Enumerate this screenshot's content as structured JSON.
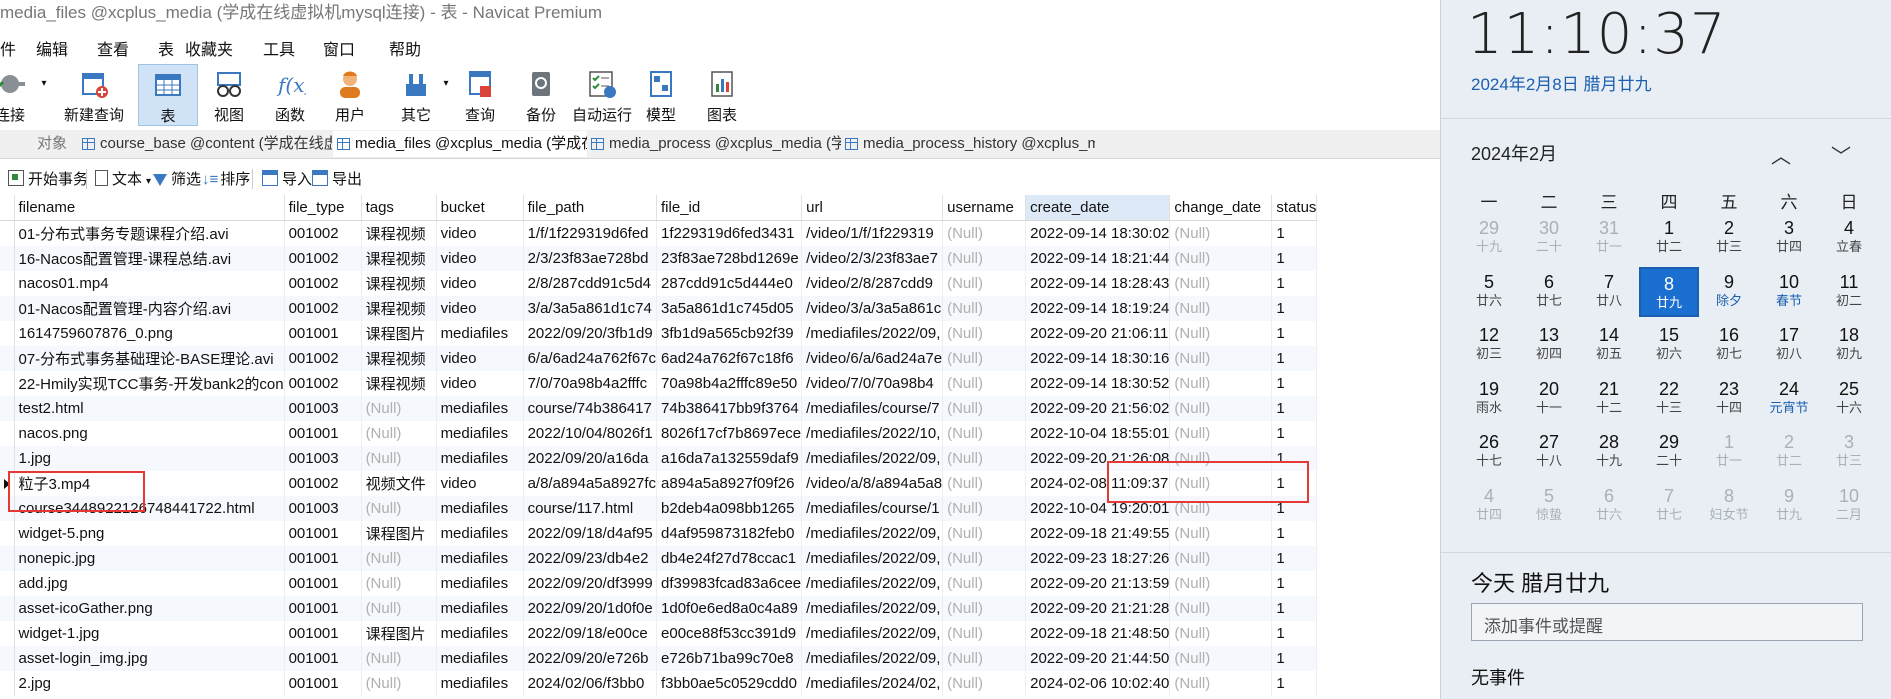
{
  "window": {
    "title": "media_files @xcplus_media (学成在线虚拟机mysql连接) - 表 - Navicat Premium"
  },
  "menu": [
    "件",
    "编辑",
    "查看",
    "表",
    "收藏夹",
    "工具",
    "窗口",
    "帮助"
  ],
  "toolbar": [
    {
      "label": "连接",
      "icon": "plug-icon"
    },
    {
      "label": "新建查询",
      "icon": "new-query-icon"
    },
    {
      "label": "表",
      "icon": "table-icon"
    },
    {
      "label": "视图",
      "icon": "view-icon"
    },
    {
      "label": "函数",
      "icon": "function-icon"
    },
    {
      "label": "用户",
      "icon": "user-icon"
    },
    {
      "label": "其它",
      "icon": "tools-icon"
    },
    {
      "label": "查询",
      "icon": "query-icon"
    },
    {
      "label": "备份",
      "icon": "backup-icon"
    },
    {
      "label": "自动运行",
      "icon": "schedule-icon"
    },
    {
      "label": "模型",
      "icon": "model-icon"
    },
    {
      "label": "图表",
      "icon": "chart-icon"
    }
  ],
  "tabs": [
    {
      "label": "对象"
    },
    {
      "label": "course_base @content (学成在线虚拟..."
    },
    {
      "label": "media_files @xcplus_media (学成在..."
    },
    {
      "label": "media_process @xcplus_media (学成..."
    },
    {
      "label": "media_process_history @xcplus_me..."
    }
  ],
  "actions": {
    "begin": "开始事务",
    "text": "文本",
    "filter": "筛选",
    "sort": "排序",
    "import": "导入",
    "export": "导出"
  },
  "grid": {
    "columns": [
      "filename",
      "file_type",
      "tags",
      "bucket",
      "file_path",
      "file_id",
      "url",
      "username",
      "create_date",
      "change_date",
      "status"
    ],
    "rows": [
      [
        "01-分布式事务专题课程介绍.avi",
        "001002",
        "课程视频",
        "video",
        "1/f/1f229319d6fed",
        "1f229319d6fed3431",
        "/video/1/f/1f229319",
        "(Null)",
        "2022-09-14 18:30:02",
        "(Null)",
        "1"
      ],
      [
        "16-Nacos配置管理-课程总结.avi",
        "001002",
        "课程视频",
        "video",
        "2/3/23f83ae728bd",
        "23f83ae728bd1269e",
        "/video/2/3/23f83ae7",
        "(Null)",
        "2022-09-14 18:21:44",
        "(Null)",
        "1"
      ],
      [
        "nacos01.mp4",
        "001002",
        "课程视频",
        "video",
        "2/8/287cdd91c5d4",
        "287cdd91c5d444e0",
        "/video/2/8/287cdd9",
        "(Null)",
        "2022-09-14 18:28:43",
        "(Null)",
        "1"
      ],
      [
        "01-Nacos配置管理-内容介绍.avi",
        "001002",
        "课程视频",
        "video",
        "3/a/3a5a861d1c74",
        "3a5a861d1c745d05",
        "/video/3/a/3a5a861c",
        "(Null)",
        "2022-09-14 18:19:24",
        "(Null)",
        "1"
      ],
      [
        "1614759607876_0.png",
        "001001",
        "课程图片",
        "mediafiles",
        "2022/09/20/3fb1d9",
        "3fb1d9a565cb92f39",
        "/mediafiles/2022/09,",
        "(Null)",
        "2022-09-20 21:06:11",
        "(Null)",
        "1"
      ],
      [
        "07-分布式事务基础理论-BASE理论.avi",
        "001002",
        "课程视频",
        "video",
        "6/a/6ad24a762f67c",
        "6ad24a762f67c18f6",
        "/video/6/a/6ad24a7e",
        "(Null)",
        "2022-09-14 18:30:16",
        "(Null)",
        "1"
      ],
      [
        "22-Hmily实现TCC事务-开发bank2的con",
        "001002",
        "课程视频",
        "video",
        "7/0/70a98b4a2fffc",
        "70a98b4a2fffc89e50",
        "/video/7/0/70a98b4",
        "(Null)",
        "2022-09-14 18:30:52",
        "(Null)",
        "1"
      ],
      [
        "test2.html",
        "001003",
        "(Null)",
        "mediafiles",
        "course/74b386417",
        "74b386417bb9f3764",
        "/mediafiles/course/7",
        "(Null)",
        "2022-09-20 21:56:02",
        "(Null)",
        "1"
      ],
      [
        "nacos.png",
        "001001",
        "(Null)",
        "mediafiles",
        "2022/10/04/8026f1",
        "8026f17cf7b8697ece",
        "/mediafiles/2022/10,",
        "(Null)",
        "2022-10-04 18:55:01",
        "(Null)",
        "1"
      ],
      [
        "1.jpg",
        "001003",
        "(Null)",
        "mediafiles",
        "2022/09/20/a16da",
        "a16da7a132559daf9",
        "/mediafiles/2022/09,",
        "(Null)",
        "2022-09-20 21:26:08",
        "(Null)",
        "1"
      ],
      [
        "粒子3.mp4",
        "001002",
        "视频文件",
        "video",
        "a/8/a894a5a8927fc",
        "a894a5a8927f09f26",
        "/video/a/8/a894a5a8",
        "(Null)",
        "2024-02-08 11:09:37",
        "(Null)",
        "1"
      ],
      [
        "course3448922126748441722.html",
        "001003",
        "(Null)",
        "mediafiles",
        "course/117.html",
        "b2deb4a098bb1265",
        "/mediafiles/course/1",
        "(Null)",
        "2022-10-04 19:20:01",
        "(Null)",
        "1"
      ],
      [
        "widget-5.png",
        "001001",
        "课程图片",
        "mediafiles",
        "2022/09/18/d4af95",
        "d4af959873182feb0",
        "/mediafiles/2022/09,",
        "(Null)",
        "2022-09-18 21:49:55",
        "(Null)",
        "1"
      ],
      [
        "nonepic.jpg",
        "001001",
        "(Null)",
        "mediafiles",
        "2022/09/23/db4e2",
        "db4e24f27d78ccac1",
        "/mediafiles/2022/09,",
        "(Null)",
        "2022-09-23 18:27:26",
        "(Null)",
        "1"
      ],
      [
        "add.jpg",
        "001001",
        "(Null)",
        "mediafiles",
        "2022/09/20/df3999",
        "df39983fcad83a6cee",
        "/mediafiles/2022/09,",
        "(Null)",
        "2022-09-20 21:13:59",
        "(Null)",
        "1"
      ],
      [
        "asset-icoGather.png",
        "001001",
        "(Null)",
        "mediafiles",
        "2022/09/20/1d0f0e",
        "1d0f0e6ed8a0c4a89",
        "/mediafiles/2022/09,",
        "(Null)",
        "2022-09-20 21:21:28",
        "(Null)",
        "1"
      ],
      [
        "widget-1.jpg",
        "001001",
        "课程图片",
        "mediafiles",
        "2022/09/18/e00ce",
        "e00ce88f53cc391d9",
        "/mediafiles/2022/09,",
        "(Null)",
        "2022-09-18 21:48:50",
        "(Null)",
        "1"
      ],
      [
        "asset-login_img.jpg",
        "001001",
        "(Null)",
        "mediafiles",
        "2022/09/20/e726b",
        "e726b71ba99c70e8",
        "/mediafiles/2022/09,",
        "(Null)",
        "2022-09-20 21:44:50",
        "(Null)",
        "1"
      ],
      [
        "2.jpg",
        "001001",
        "(Null)",
        "mediafiles",
        "2024/02/06/f3bb0",
        "f3bb0ae5c0529cdd0",
        "/mediafiles/2024/02,",
        "(Null)",
        "2024-02-06 10:02:40",
        "(Null)",
        "1"
      ]
    ]
  },
  "calendar": {
    "time": "11:10:37",
    "date_line": "2024年2月8日 腊月廿九",
    "month": "2024年2月",
    "nav_up": "︿",
    "nav_down": "﹀",
    "weekdays": [
      "一",
      "二",
      "三",
      "四",
      "五",
      "六",
      "日"
    ],
    "days": [
      {
        "d": "29",
        "l": "十九",
        "out": true
      },
      {
        "d": "30",
        "l": "二十",
        "out": true
      },
      {
        "d": "31",
        "l": "廿一",
        "out": true
      },
      {
        "d": "1",
        "l": "廿二"
      },
      {
        "d": "2",
        "l": "廿三"
      },
      {
        "d": "3",
        "l": "廿四"
      },
      {
        "d": "4",
        "l": "立春"
      },
      {
        "d": "5",
        "l": "廿六"
      },
      {
        "d": "6",
        "l": "廿七"
      },
      {
        "d": "7",
        "l": "廿八"
      },
      {
        "d": "8",
        "l": "廿九",
        "today": true
      },
      {
        "d": "9",
        "l": "除夕",
        "fest": true
      },
      {
        "d": "10",
        "l": "春节",
        "fest": true
      },
      {
        "d": "11",
        "l": "初二"
      },
      {
        "d": "12",
        "l": "初三"
      },
      {
        "d": "13",
        "l": "初四"
      },
      {
        "d": "14",
        "l": "初五"
      },
      {
        "d": "15",
        "l": "初六"
      },
      {
        "d": "16",
        "l": "初七"
      },
      {
        "d": "17",
        "l": "初八"
      },
      {
        "d": "18",
        "l": "初九"
      },
      {
        "d": "19",
        "l": "雨水"
      },
      {
        "d": "20",
        "l": "十一"
      },
      {
        "d": "21",
        "l": "十二"
      },
      {
        "d": "22",
        "l": "十三"
      },
      {
        "d": "23",
        "l": "十四"
      },
      {
        "d": "24",
        "l": "元宵节",
        "fest": true
      },
      {
        "d": "25",
        "l": "十六"
      },
      {
        "d": "26",
        "l": "十七"
      },
      {
        "d": "27",
        "l": "十八"
      },
      {
        "d": "28",
        "l": "十九"
      },
      {
        "d": "29",
        "l": "二十"
      },
      {
        "d": "1",
        "l": "廿一",
        "out": true
      },
      {
        "d": "2",
        "l": "廿二",
        "out": true
      },
      {
        "d": "3",
        "l": "廿三",
        "out": true
      },
      {
        "d": "4",
        "l": "廿四",
        "out": true
      },
      {
        "d": "5",
        "l": "惊蛰",
        "out": true
      },
      {
        "d": "6",
        "l": "廿六",
        "out": true
      },
      {
        "d": "7",
        "l": "廿七",
        "out": true
      },
      {
        "d": "8",
        "l": "妇女节",
        "out": true
      },
      {
        "d": "9",
        "l": "廿九",
        "out": true
      },
      {
        "d": "10",
        "l": "二月",
        "out": true
      }
    ],
    "today_title": "今天 腊月廿九",
    "event_placeholder": "添加事件或提醒",
    "no_event": "无事件"
  },
  "colors": {
    "accent": "#1a6fd0",
    "highlight_box": "#e53935",
    "null_text": "#b0b0b0"
  }
}
